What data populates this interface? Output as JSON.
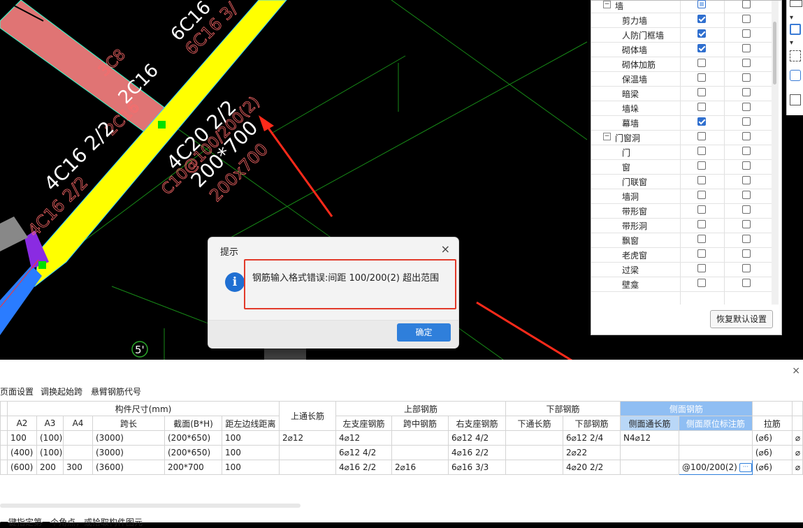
{
  "cad": {
    "labels": {
      "beam_top_right": "6C16",
      "beam_top_right_red": "6C16 3/",
      "mid_2c16": "2C16",
      "red_3c8": "3C8",
      "red_2c16": "2C16",
      "label_4c16": "4C16 2/2",
      "red_4c16": "4C16 2/2",
      "label_4c20": "4C20 2/2",
      "label_200x700": "200*700",
      "red_200x700": "200x700",
      "red_c10": "C10@100/200(2)",
      "axis_5": "5'"
    }
  },
  "layer_panel": {
    "rows": [
      {
        "label": "墙",
        "level": 0,
        "toggle": "−",
        "show": "partial",
        "name_col": false
      },
      {
        "label": "剪力墙",
        "level": 1,
        "show": true,
        "name_col": false
      },
      {
        "label": "人防门框墙",
        "level": 1,
        "show": true,
        "name_col": false
      },
      {
        "label": "砌体墙",
        "level": 1,
        "show": true,
        "name_col": false
      },
      {
        "label": "砌体加筋",
        "level": 1,
        "show": false,
        "name_col": false
      },
      {
        "label": "保温墙",
        "level": 1,
        "show": false,
        "name_col": false
      },
      {
        "label": "暗梁",
        "level": 1,
        "show": false,
        "name_col": false
      },
      {
        "label": "墙垛",
        "level": 1,
        "show": false,
        "name_col": false
      },
      {
        "label": "幕墙",
        "level": 1,
        "show": true,
        "name_col": false
      },
      {
        "label": "门窗洞",
        "level": 0,
        "toggle": "−",
        "show": false,
        "name_col": false
      },
      {
        "label": "门",
        "level": 1,
        "show": false,
        "name_col": false
      },
      {
        "label": "窗",
        "level": 1,
        "show": false,
        "name_col": false
      },
      {
        "label": "门联窗",
        "level": 1,
        "show": false,
        "name_col": false
      },
      {
        "label": "墙洞",
        "level": 1,
        "show": false,
        "name_col": false
      },
      {
        "label": "带形窗",
        "level": 1,
        "show": false,
        "name_col": false
      },
      {
        "label": "带形洞",
        "level": 1,
        "show": false,
        "name_col": false
      },
      {
        "label": "飘窗",
        "level": 1,
        "show": false,
        "name_col": false
      },
      {
        "label": "老虎窗",
        "level": 1,
        "show": false,
        "name_col": false
      },
      {
        "label": "过梁",
        "level": 1,
        "show": false,
        "name_col": false
      },
      {
        "label": "壁龛",
        "level": 1,
        "show": false,
        "name_col": false
      }
    ],
    "restore_label": "恢复默认设置"
  },
  "dialog": {
    "title": "提示",
    "message": "钢筋输入格式错误:间距 100/200(2) 超出范围",
    "ok_label": "确定",
    "close_icon": "×",
    "info_icon": "i"
  },
  "grid": {
    "toolbar": [
      "页面设置",
      "调换起始跨",
      "悬臂钢筋代号"
    ],
    "group_headers": {
      "size": "构件尺寸(mm)",
      "top_through": "上通长筋",
      "top_rebar": "上部钢筋",
      "bottom_rebar": "下部钢筋",
      "side_rebar": "侧面钢筋"
    },
    "columns": [
      "A2",
      "A3",
      "A4",
      "跨长",
      "截面(B*H)",
      "距左边线距离",
      "",
      "左支座钢筋",
      "跨中钢筋",
      "右支座钢筋",
      "下通长筋",
      "下部钢筋",
      "侧面通长筋",
      "侧面原位标注筋",
      "拉筋",
      ""
    ],
    "rows": [
      [
        "100",
        "(100)",
        "",
        "(3000)",
        "(200*650)",
        "100",
        "2⌀12",
        "4⌀12",
        "",
        "6⌀12 4/2",
        "",
        "6⌀12 2/4",
        "N4⌀12",
        "",
        "(⌀6)",
        "⌀"
      ],
      [
        "(400)",
        "(100)",
        "",
        "(3000)",
        "(200*650)",
        "100",
        "",
        "6⌀12 4/2",
        "",
        "4⌀16 2/2",
        "",
        "2⌀22",
        "",
        "",
        "(⌀6)",
        "⌀"
      ],
      [
        "(600)",
        "200",
        "300",
        "(3600)",
        "200*700",
        "100",
        "",
        "4⌀16 2/2",
        "2⌀16",
        "6⌀16 3/3",
        "",
        "4⌀20 2/2",
        "",
        "@100/200(2)",
        "(⌀6)",
        "⌀"
      ]
    ],
    "edit_icon": "···",
    "status": "一键指定第一个角点，或拾取构件图元"
  },
  "colors": {
    "accent": "#2f7fdb",
    "beam_yellow": "#ffff00",
    "beam_pink": "#e07070",
    "cad_green": "#1a8a1a",
    "arrow_red": "#ff2a1a",
    "header_blue": "#8fbef3"
  }
}
